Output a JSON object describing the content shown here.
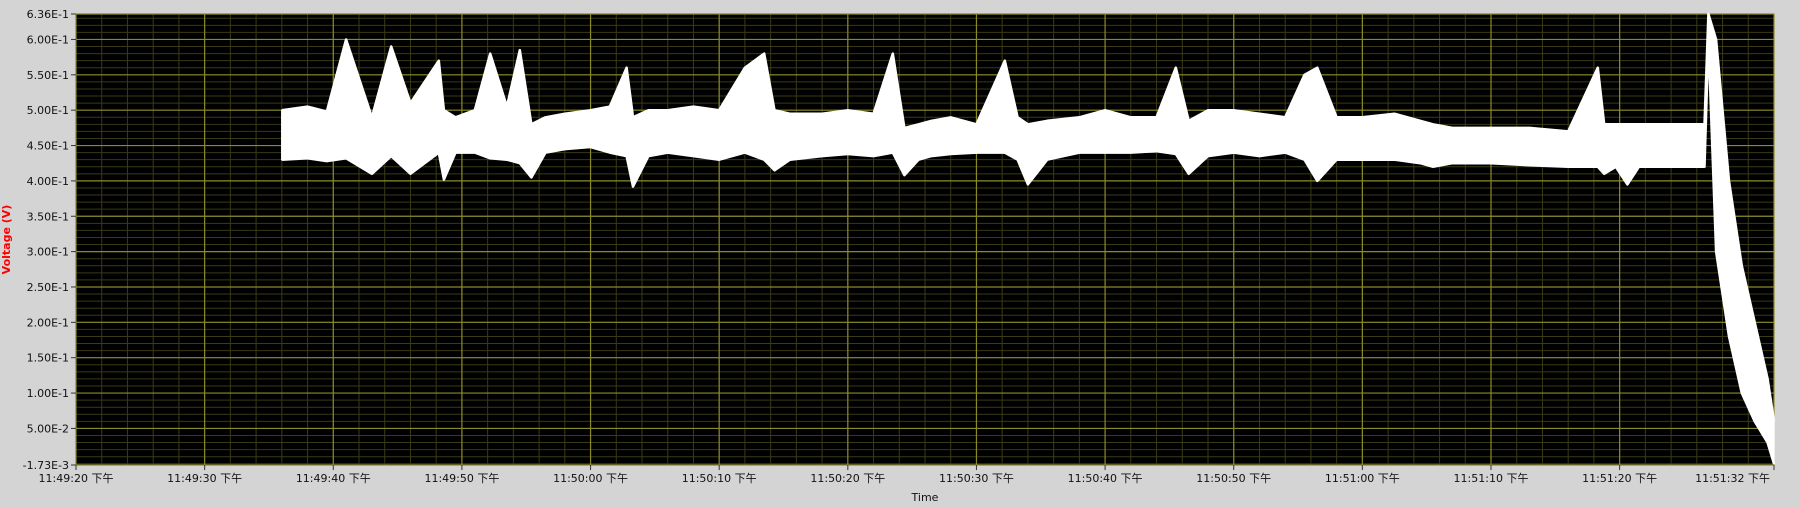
{
  "chart_data": {
    "type": "line",
    "title": "",
    "xlabel": "Time",
    "ylabel": "Voltage (V)",
    "x_ticks": [
      "11:49:20 下午",
      "11:49:30 下午",
      "11:49:40 下午",
      "11:49:50 下午",
      "11:50:00 下午",
      "11:50:10 下午",
      "11:50:20 下午",
      "11:50:30 下午",
      "11:50:40 下午",
      "11:50:50 下午",
      "11:51:00 下午",
      "11:51:10 下午",
      "11:51:20 下午",
      "11:51:32 下午"
    ],
    "x_tick_seconds": [
      0,
      10,
      20,
      30,
      40,
      50,
      60,
      70,
      80,
      90,
      100,
      110,
      120,
      132
    ],
    "y_ticks": [
      "-1.73E-3",
      "5.00E-2",
      "1.00E-1",
      "1.50E-1",
      "2.00E-1",
      "2.50E-1",
      "3.00E-1",
      "3.50E-1",
      "4.00E-1",
      "4.50E-1",
      "5.00E-1",
      "5.50E-1",
      "6.00E-1",
      "6.36E-1"
    ],
    "y_tick_values": [
      -0.00173,
      0.05,
      0.1,
      0.15,
      0.2,
      0.25,
      0.3,
      0.35,
      0.4,
      0.45,
      0.5,
      0.55,
      0.6,
      0.636
    ],
    "ylim": [
      -0.00173,
      0.636
    ],
    "xlim_seconds": [
      0,
      132
    ],
    "grid": true,
    "minor_grid": true,
    "colors": {
      "plot_background": "#000000",
      "major_grid": "#8a8a2a",
      "minor_grid": "#3a3a16",
      "trace": "#ffffff",
      "ylabel": "#ff0000",
      "frame": "#d4d4d4"
    },
    "series": [
      {
        "x": [
          16,
          18,
          19.5,
          21,
          23,
          24.5,
          26,
          28.2,
          28.6,
          29.5,
          31,
          32.2,
          33.5,
          34.5,
          35.4,
          36.5,
          38,
          40,
          41.5,
          42.8,
          43.3,
          44.5,
          46,
          48,
          50,
          52,
          53.5,
          54.3,
          55.5,
          58,
          60,
          62,
          63.5,
          64.4,
          65.5,
          66.5,
          68,
          70,
          72.2,
          73.2,
          74,
          75.5,
          78,
          80,
          82,
          84,
          85.5,
          86.5,
          88,
          90,
          92,
          94,
          95.5,
          96.5,
          98,
          100,
          102.5,
          104.5,
          105.5,
          107,
          110,
          113,
          116,
          118.3,
          118.8,
          119.7,
          120.6,
          121.5,
          123,
          125,
          126.6,
          126.9,
          127.5,
          128.5,
          129.5,
          130.5,
          131.5,
          132
        ],
        "ymin": [
          0.43,
          0.432,
          0.428,
          0.432,
          0.41,
          0.435,
          0.41,
          0.44,
          0.402,
          0.44,
          0.44,
          0.432,
          0.43,
          0.425,
          0.405,
          0.44,
          0.445,
          0.448,
          0.44,
          0.435,
          0.392,
          0.435,
          0.44,
          0.435,
          0.43,
          0.44,
          0.43,
          0.415,
          0.43,
          0.435,
          0.438,
          0.435,
          0.44,
          0.408,
          0.43,
          0.435,
          0.438,
          0.44,
          0.44,
          0.43,
          0.395,
          0.43,
          0.44,
          0.44,
          0.44,
          0.442,
          0.438,
          0.41,
          0.435,
          0.44,
          0.435,
          0.44,
          0.43,
          0.4,
          0.43,
          0.43,
          0.43,
          0.425,
          0.42,
          0.425,
          0.425,
          0.422,
          0.42,
          0.42,
          0.41,
          0.42,
          0.395,
          0.42,
          0.42,
          0.42,
          0.42,
          0.6,
          0.3,
          0.18,
          0.1,
          0.06,
          0.03,
          0.0
        ],
        "ymax": [
          0.5,
          0.505,
          0.498,
          0.6,
          0.49,
          0.59,
          0.51,
          0.57,
          0.5,
          0.49,
          0.5,
          0.58,
          0.505,
          0.585,
          0.48,
          0.49,
          0.495,
          0.5,
          0.505,
          0.56,
          0.49,
          0.5,
          0.5,
          0.505,
          0.5,
          0.56,
          0.58,
          0.5,
          0.495,
          0.495,
          0.5,
          0.495,
          0.58,
          0.475,
          0.48,
          0.485,
          0.49,
          0.48,
          0.57,
          0.49,
          0.48,
          0.485,
          0.49,
          0.5,
          0.49,
          0.49,
          0.56,
          0.485,
          0.5,
          0.5,
          0.495,
          0.49,
          0.55,
          0.56,
          0.49,
          0.49,
          0.495,
          0.485,
          0.48,
          0.475,
          0.475,
          0.475,
          0.47,
          0.56,
          0.48,
          0.48,
          0.48,
          0.48,
          0.48,
          0.48,
          0.48,
          0.636,
          0.6,
          0.4,
          0.28,
          0.2,
          0.12,
          0.06
        ]
      }
    ]
  }
}
